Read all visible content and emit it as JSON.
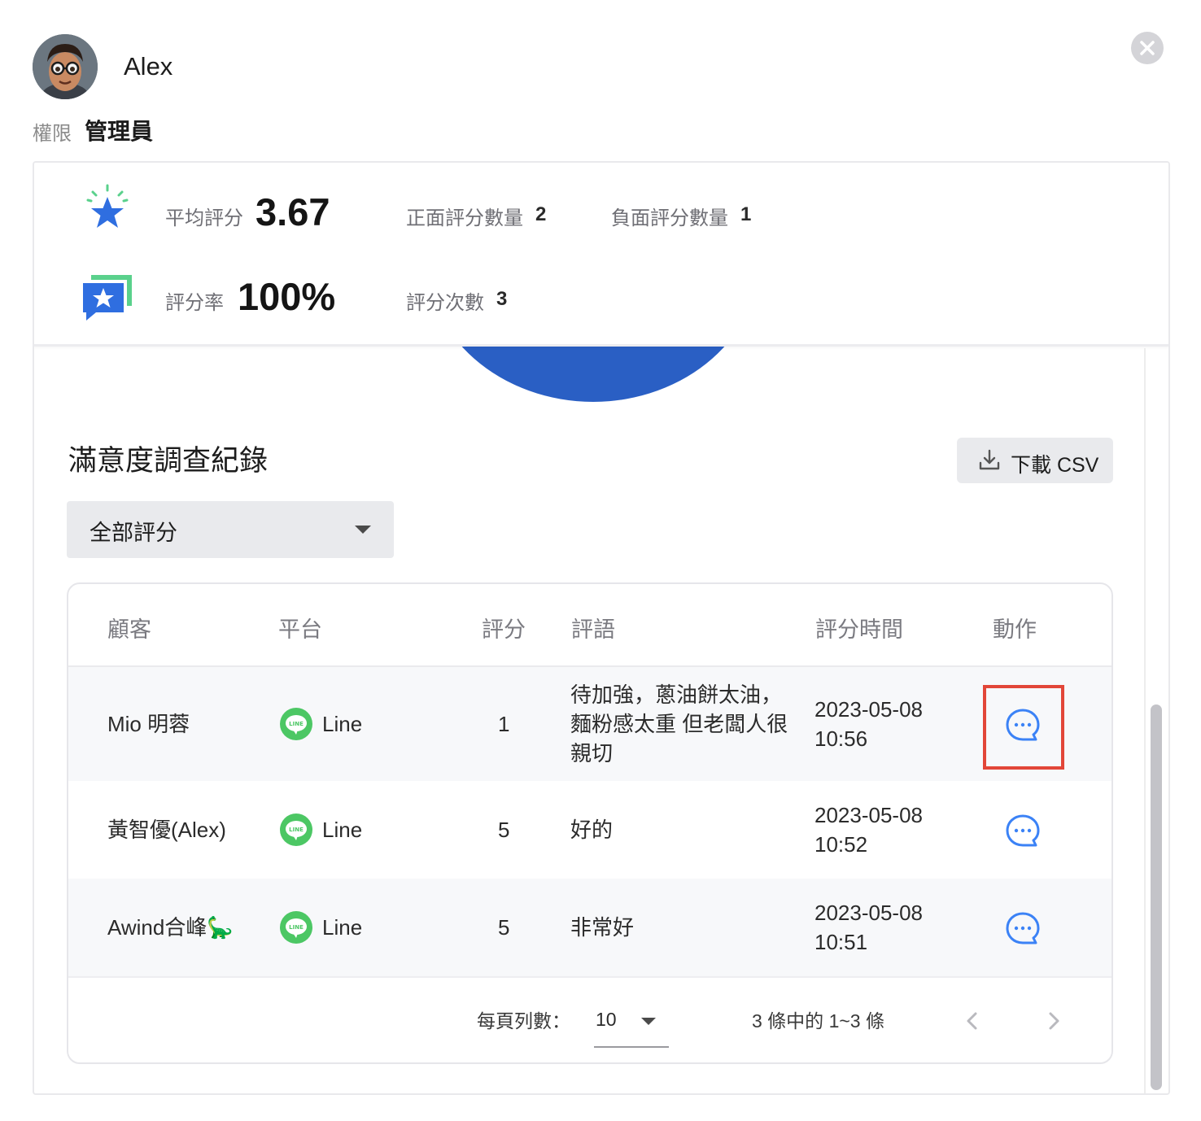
{
  "user": {
    "name": "Alex",
    "permission_label": "權限",
    "permission_value": "管理員"
  },
  "stats": {
    "avg_label": "平均評分",
    "avg_value": "3.67",
    "positive_label": "正面評分數量",
    "positive_value": "2",
    "negative_label": "負面評分數量",
    "negative_value": "1",
    "rate_label": "評分率",
    "rate_value": "100%",
    "count_label": "評分次數",
    "count_value": "3"
  },
  "section": {
    "title": "滿意度調查紀錄",
    "csv_label": "下載 CSV",
    "filter_value": "全部評分"
  },
  "table": {
    "headers": [
      "顧客",
      "平台",
      "評分",
      "評語",
      "評分時間",
      "動作"
    ],
    "rows": [
      {
        "customer": "Mio 明蓉",
        "platform": "Line",
        "score": "1",
        "comment": "待加強，蔥油餅太油，麵粉感太重 但老闆人很親切",
        "time_date": "2023-05-08",
        "time_clock": "10:56"
      },
      {
        "customer": "黃智優(Alex)",
        "platform": "Line",
        "score": "5",
        "comment": "好的",
        "time_date": "2023-05-08",
        "time_clock": "10:52"
      },
      {
        "customer": "Awind合峰🦕",
        "platform": "Line",
        "score": "5",
        "comment": "非常好",
        "time_date": "2023-05-08",
        "time_clock": "10:51"
      }
    ],
    "line_badge": "LINE"
  },
  "pagination": {
    "rows_per_page_label": "每頁列數：",
    "rows_per_page_value": "10",
    "range_text": "3 條中的 1~3 條"
  },
  "colors": {
    "accent_blue": "#2a5fc4",
    "line_green": "#4cc764",
    "highlight_red": "#e24638",
    "action_blue": "#3b82f6"
  }
}
